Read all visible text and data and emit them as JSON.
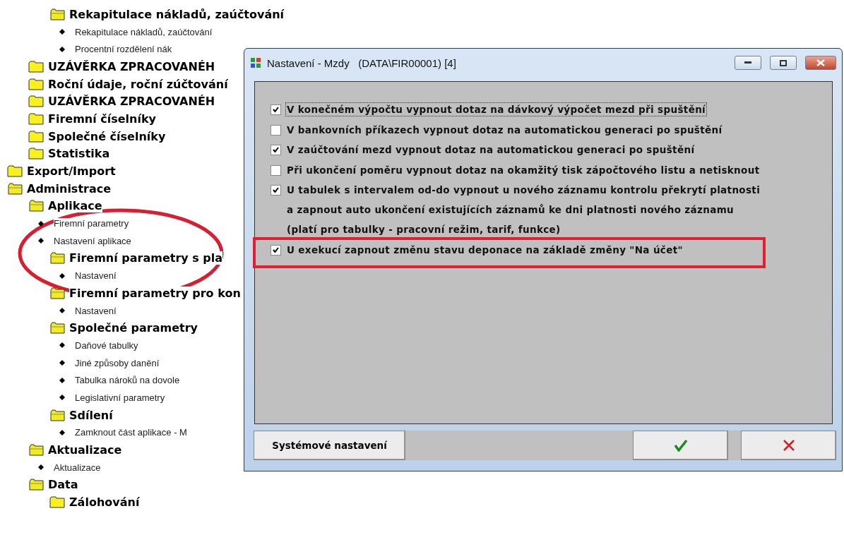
{
  "tree": [
    {
      "children": [
        {
          "children": [
            {
              "label": "Rekapitulace nákladů, zaúčtování",
              "kind": "folder",
              "expanded": true,
              "children": [
                {
                  "label": "Rekapitulace nákladů, zaúčtování",
                  "kind": "leaf"
                },
                {
                  "label": "Procentní rozdělení nák",
                  "kind": "leaf"
                }
              ]
            }
          ]
        },
        {
          "label": "UZÁVĚRKA ZPRACOVANÉH",
          "kind": "folder",
          "expanded": false
        },
        {
          "label": "Roční údaje, roční zúčtování",
          "kind": "folder",
          "expanded": false
        },
        {
          "label": "UZÁVĚRKA ZPRACOVANÉH",
          "kind": "folder",
          "expanded": false
        },
        {
          "label": "Firemní číselníky",
          "kind": "folder",
          "expanded": false
        },
        {
          "label": "Společné číselníky",
          "kind": "folder",
          "expanded": false
        },
        {
          "label": "Statistika",
          "kind": "folder",
          "expanded": false
        }
      ]
    },
    {
      "label": "Export/Import",
      "kind": "folder",
      "expanded": false
    },
    {
      "label": "Administrace",
      "kind": "folder",
      "expanded": true,
      "children": [
        {
          "label": "Aplikace",
          "kind": "folder",
          "expanded": true,
          "children": [
            {
              "label": "Firemní parametry",
              "kind": "leaf"
            },
            {
              "label": "Nastavení aplikace",
              "kind": "leaf"
            },
            {
              "label": "Firemní parametry s pla",
              "kind": "folder",
              "expanded": true,
              "children": [
                {
                  "label": "Nastavení",
                  "kind": "leaf"
                }
              ]
            },
            {
              "label": "Firemní parametry pro kon",
              "kind": "folder",
              "expanded": true,
              "children": [
                {
                  "label": "Nastavení",
                  "kind": "leaf"
                }
              ]
            },
            {
              "label": "Společné parametry",
              "kind": "folder",
              "expanded": true,
              "children": [
                {
                  "label": "Daňové tabulky",
                  "kind": "leaf"
                },
                {
                  "label": "Jiné způsoby danění",
                  "kind": "leaf"
                },
                {
                  "label": "Tabulka nároků na dovole",
                  "kind": "leaf"
                },
                {
                  "label": "Legislativní parametry",
                  "kind": "leaf"
                }
              ]
            },
            {
              "label": "Sdílení",
              "kind": "folder",
              "expanded": true,
              "children": [
                {
                  "label": "Zamknout část aplikace - M",
                  "kind": "leaf"
                }
              ]
            }
          ]
        },
        {
          "label": "Aktualizace",
          "kind": "folder",
          "expanded": true,
          "children": [
            {
              "label": "Aktualizace",
              "kind": "leaf"
            }
          ]
        },
        {
          "label": "Data",
          "kind": "folder",
          "expanded": true,
          "children": [
            {
              "label": "Zálohování",
              "kind": "folder",
              "expanded": false
            }
          ]
        }
      ]
    }
  ],
  "dialog": {
    "title": "Nastavení - Mzdy   (DATA\\FIR00001) [4]",
    "options": [
      {
        "lines": [
          "V konečném výpočtu vypnout dotaz na dávkový výpočet mezd při spuštění"
        ],
        "checked": true,
        "focused": true
      },
      {
        "lines": [
          "V bankovních příkazech vypnout dotaz na automatickou generaci po spuštění"
        ],
        "checked": false,
        "focused": false
      },
      {
        "lines": [
          "V zaúčtování mezd vypnout dotaz na automatickou generaci po spuštění"
        ],
        "checked": true,
        "focused": false
      },
      {
        "lines": [
          "Při ukončení poměru vypnout dotaz na okamžitý tisk zápočtového listu a netisknout"
        ],
        "checked": false,
        "focused": false
      },
      {
        "lines": [
          "U tabulek s intervalem od-do vypnout u nového záznamu kontrolu překrytí platnosti",
          "a zapnout auto ukončení existujících záznamů ke dni platnosti nového záznamu",
          "(platí pro tabulky - pracovní režim, tarif, funkce)"
        ],
        "checked": true,
        "focused": false
      },
      {
        "lines": [
          "U exekucí zapnout změnu stavu deponace na základě změny \"Na účet\""
        ],
        "checked": true,
        "focused": false
      }
    ],
    "system_button": "Systémové nastavení"
  }
}
